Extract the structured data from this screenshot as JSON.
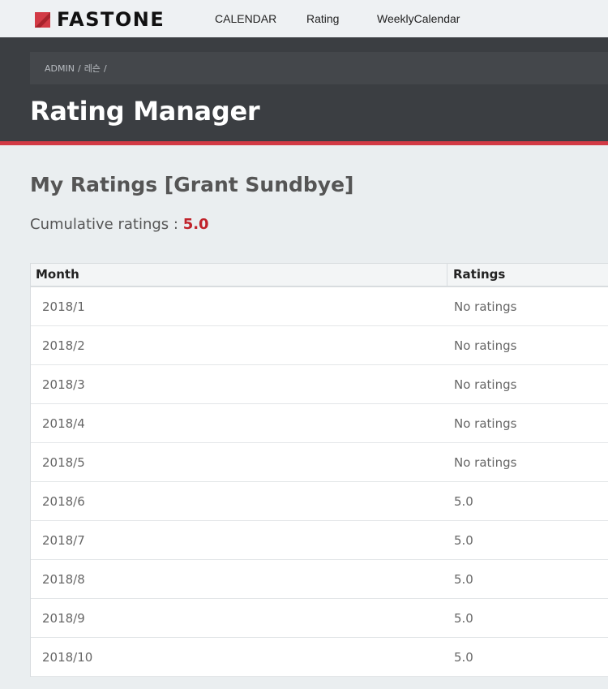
{
  "brand": {
    "name": "FASTONE",
    "accent_color": "#d23a45"
  },
  "nav": {
    "items": [
      {
        "label": "CALENDAR"
      },
      {
        "label": "Rating"
      },
      {
        "label": "WeeklyCalendar"
      }
    ]
  },
  "breadcrumb": {
    "items": [
      {
        "label": "ADMIN"
      },
      {
        "label": "레슨"
      }
    ],
    "separator": "/"
  },
  "page": {
    "title": "Rating Manager"
  },
  "ratings": {
    "title": "My Ratings [Grant Sundbye]",
    "cumulative_label": "Cumulative ratings :",
    "cumulative_value": "5.0",
    "columns": [
      "Month",
      "Ratings"
    ],
    "rows": [
      {
        "month": "2018/1",
        "rating": "No ratings"
      },
      {
        "month": "2018/2",
        "rating": "No ratings"
      },
      {
        "month": "2018/3",
        "rating": "No ratings"
      },
      {
        "month": "2018/4",
        "rating": "No ratings"
      },
      {
        "month": "2018/5",
        "rating": "No ratings"
      },
      {
        "month": "2018/6",
        "rating": "5.0"
      },
      {
        "month": "2018/7",
        "rating": "5.0"
      },
      {
        "month": "2018/8",
        "rating": "5.0"
      },
      {
        "month": "2018/9",
        "rating": "5.0"
      },
      {
        "month": "2018/10",
        "rating": "5.0"
      }
    ]
  }
}
